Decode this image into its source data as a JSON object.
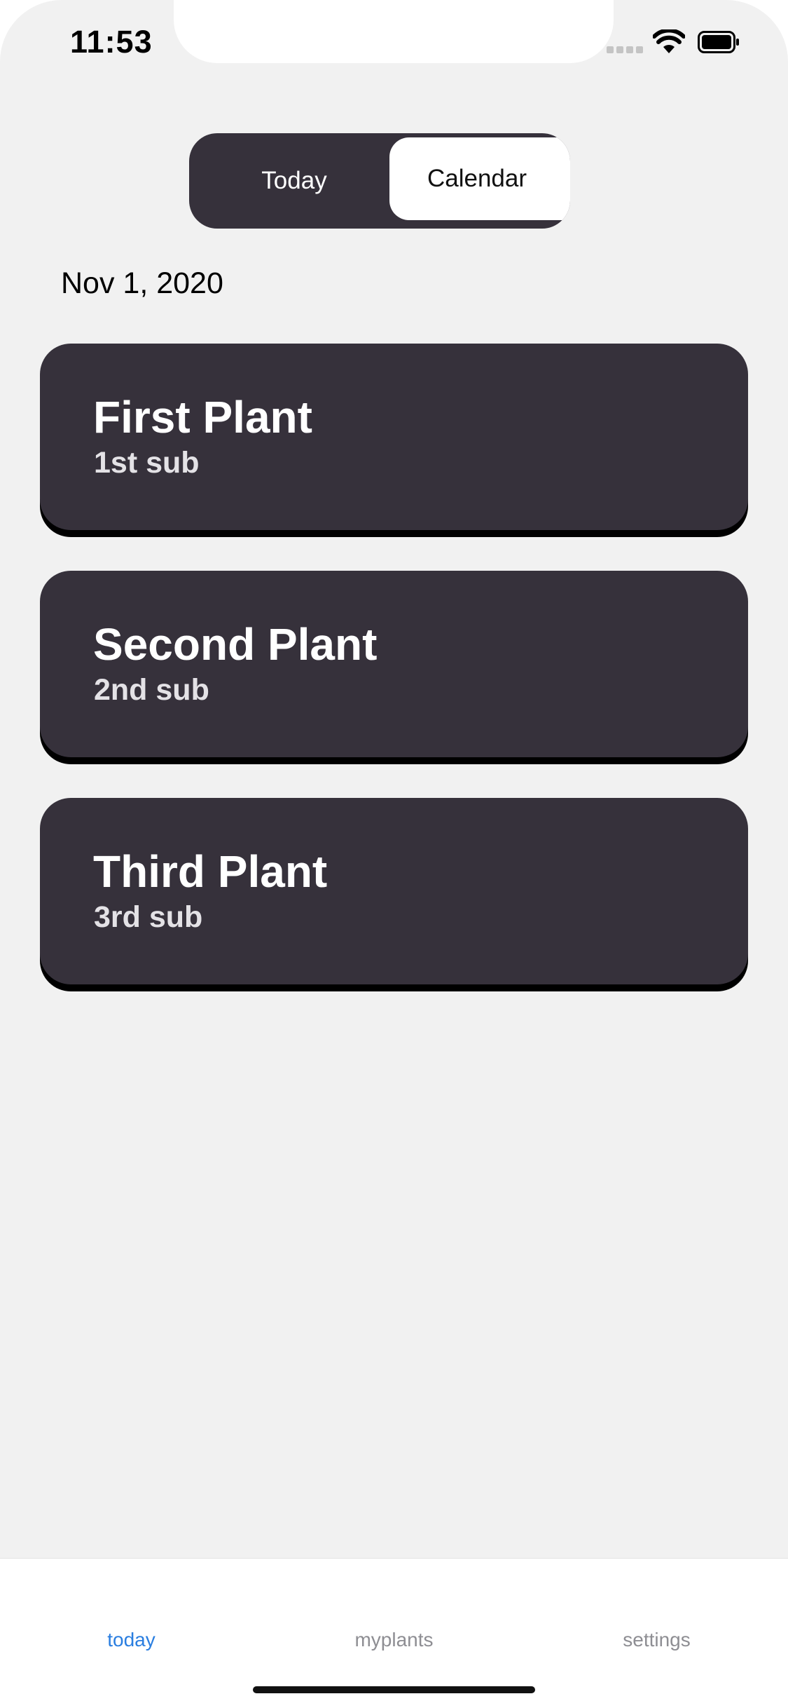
{
  "status_bar": {
    "time": "11:53",
    "signal_icon": "cellular-signal-icon",
    "wifi_icon": "wifi-icon",
    "battery_icon": "battery-icon"
  },
  "segmented": {
    "options": [
      "Today",
      "Calendar"
    ],
    "selected": "Today"
  },
  "date": "Nov 1, 2020",
  "plants": [
    {
      "title": "First Plant",
      "subtitle": "1st sub"
    },
    {
      "title": "Second Plant",
      "subtitle": "2nd sub"
    },
    {
      "title": "Third Plant",
      "subtitle": "3rd sub"
    }
  ],
  "tabbar": {
    "tabs": [
      "today",
      "myplants",
      "settings"
    ],
    "active": "today"
  },
  "colors": {
    "background": "#f1f1f1",
    "card": "#36313b",
    "accent": "#2a7ee0",
    "tab_inactive": "#8e8e93"
  }
}
